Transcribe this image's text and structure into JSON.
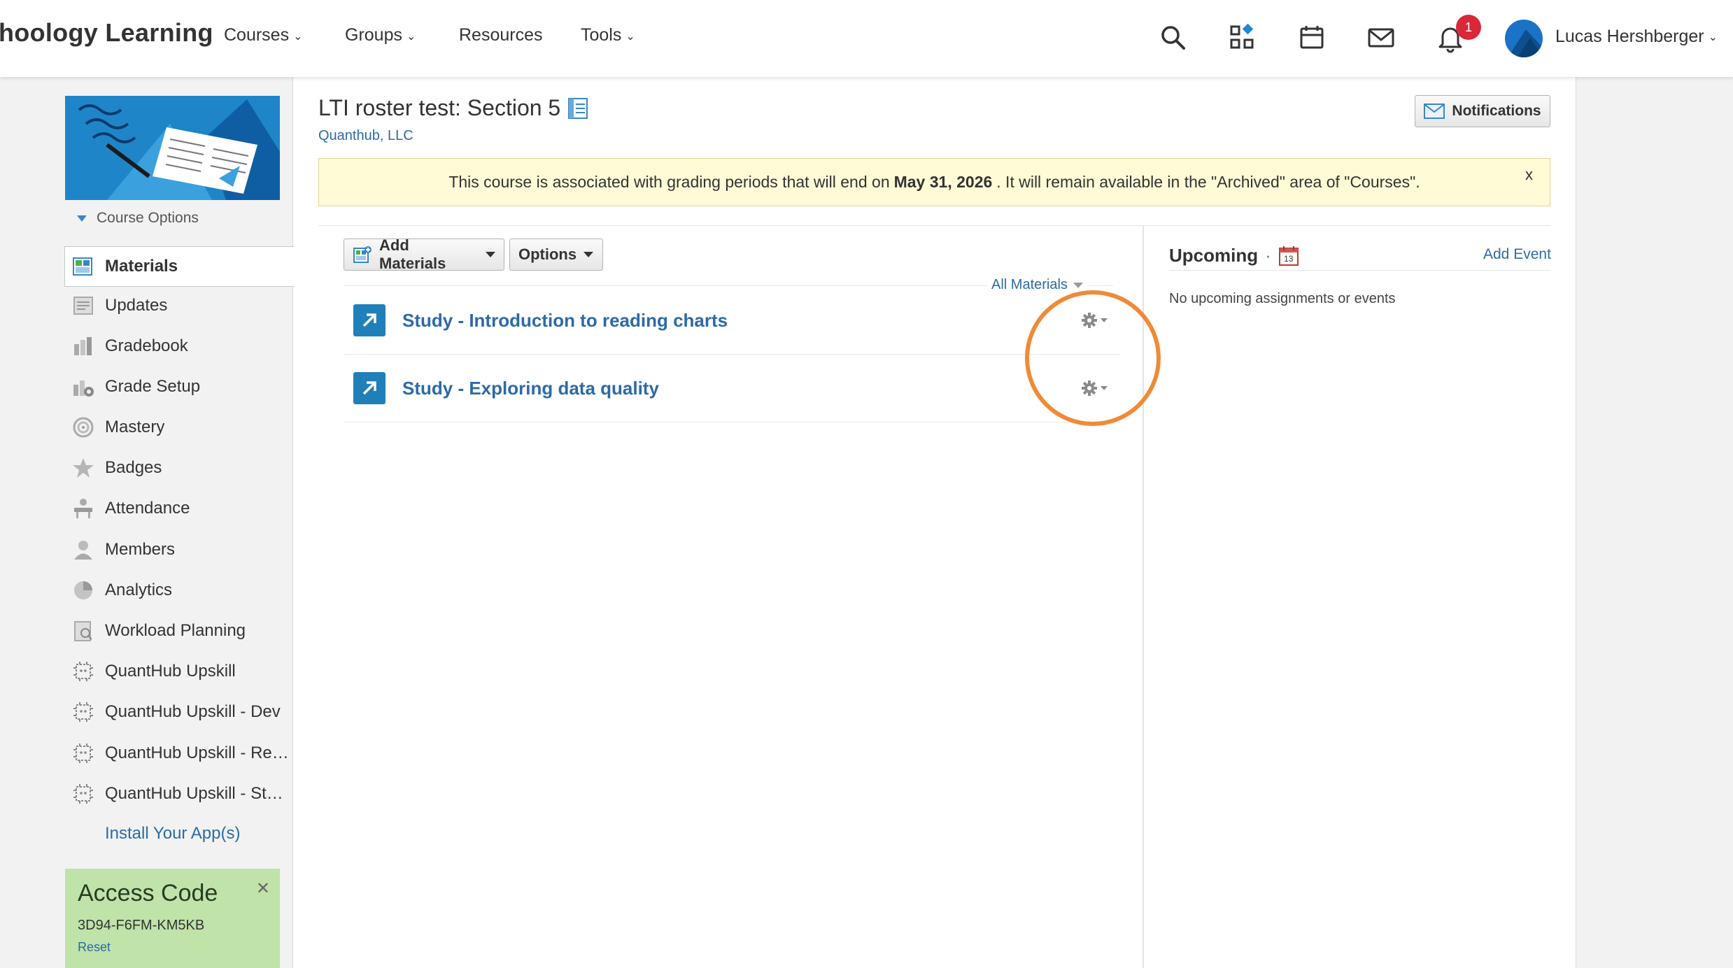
{
  "brand": "hoology Learning",
  "nav": {
    "courses": "Courses",
    "groups": "Groups",
    "resources": "Resources",
    "tools": "Tools"
  },
  "header_icons": [
    "search-icon",
    "apps-icon",
    "calendar-icon",
    "mail-icon",
    "bell-icon"
  ],
  "notification_count": "1",
  "user": {
    "name": "Lucas Hershberger"
  },
  "sidebar": {
    "course_options": "Course Options",
    "items": [
      {
        "label": "Materials",
        "icon": "materials-icon"
      },
      {
        "label": "Updates",
        "icon": "updates-icon"
      },
      {
        "label": "Gradebook",
        "icon": "gradebook-icon"
      },
      {
        "label": "Grade Setup",
        "icon": "grade-setup-icon"
      },
      {
        "label": "Mastery",
        "icon": "mastery-icon"
      },
      {
        "label": "Badges",
        "icon": "badges-icon"
      },
      {
        "label": "Attendance",
        "icon": "attendance-icon"
      },
      {
        "label": "Members",
        "icon": "members-icon"
      },
      {
        "label": "Analytics",
        "icon": "analytics-icon"
      },
      {
        "label": "Workload Planning",
        "icon": "workload-icon"
      },
      {
        "label": "QuantHub Upskill",
        "icon": "app-icon"
      },
      {
        "label": "QuantHub Upskill - Dev",
        "icon": "app-icon"
      },
      {
        "label": "QuantHub Upskill - Review",
        "icon": "app-icon"
      },
      {
        "label": "QuantHub Upskill - Staging",
        "icon": "app-icon"
      }
    ],
    "install_apps": "Install Your App(s)"
  },
  "access_code": {
    "title": "Access Code",
    "code": "3D94-F6FM-KM5KB",
    "reset": "Reset"
  },
  "course": {
    "title": "LTI roster test: Section 5",
    "org": "Quanthub, LLC"
  },
  "notifications_button": "Notifications",
  "banner": {
    "before": "This course is associated with grading periods that will end on",
    "date": "May 31, 2026",
    "after": ". It will remain available in the \"Archived\" area of \"Courses\".",
    "close": "x"
  },
  "toolbar": {
    "add_materials": "Add Materials",
    "options": "Options"
  },
  "filter": "All Materials",
  "materials": [
    {
      "title": "Study - Introduction to reading charts"
    },
    {
      "title": "Study - Exploring data quality"
    }
  ],
  "upcoming": {
    "title": "Upcoming",
    "separator": "·",
    "calendar_day": "13",
    "add_event": "Add Event",
    "empty": "No upcoming assignments or events"
  },
  "colors": {
    "link": "#2c6aa8",
    "banner_bg": "#fffbd6",
    "access_bg": "#bfe3a9",
    "highlight": "#f08a36",
    "badge": "#d8283a"
  }
}
